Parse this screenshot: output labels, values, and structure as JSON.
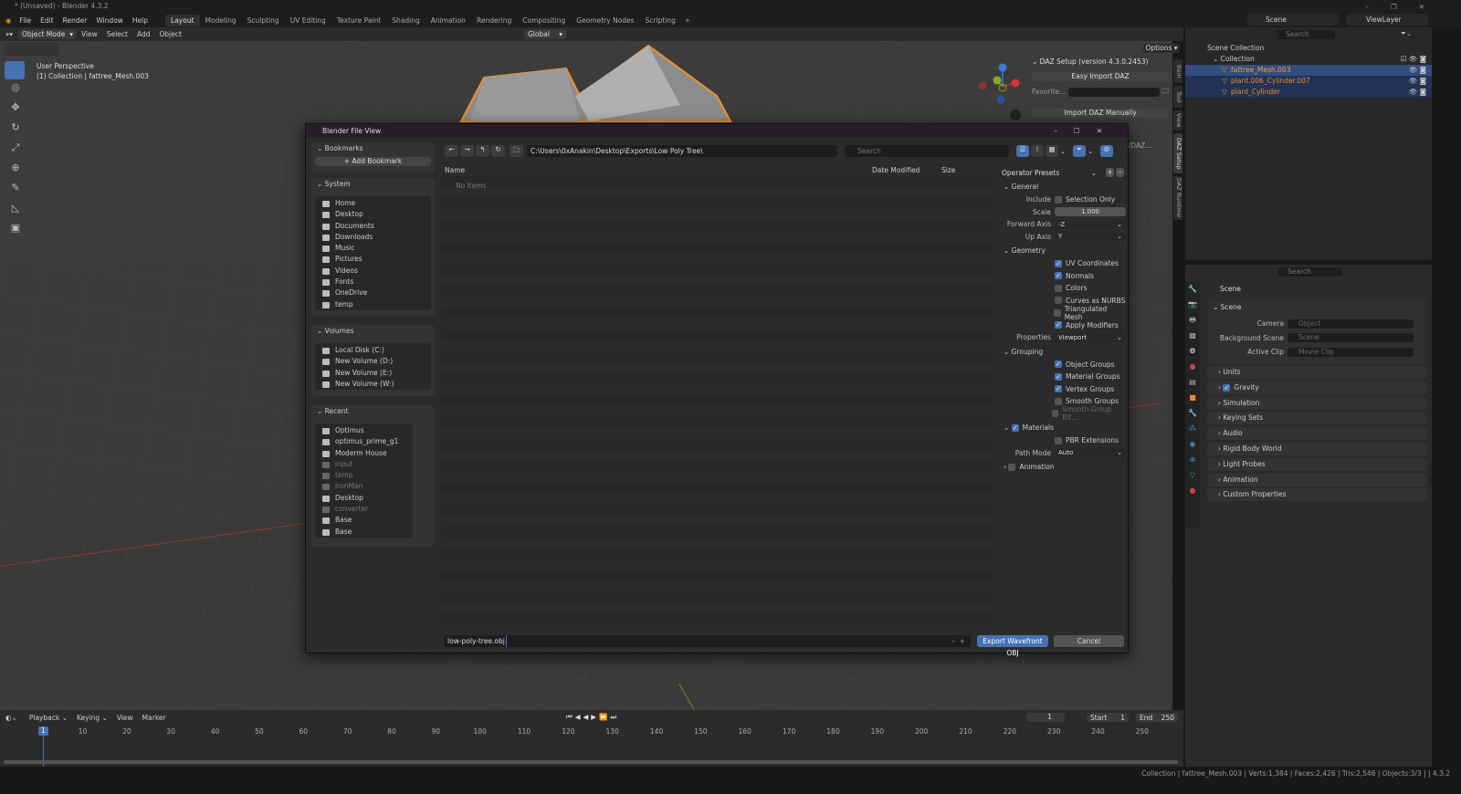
{
  "window": {
    "title": "* (Unsaved) - Blender 4.3.2"
  },
  "menu": [
    "File",
    "Edit",
    "Render",
    "Window",
    "Help"
  ],
  "workspaces": [
    "Layout",
    "Modeling",
    "Sculpting",
    "UV Editing",
    "Texture Paint",
    "Shading",
    "Animation",
    "Rendering",
    "Compositing",
    "Geometry Nodes",
    "Scripting"
  ],
  "active_workspace": "Layout",
  "scene": {
    "label": "Scene",
    "view_layer": "ViewLayer"
  },
  "viewport_header": {
    "mode": "Object Mode",
    "menus": [
      "View",
      "Select",
      "Add",
      "Object"
    ],
    "orientation": "Global",
    "options": "Options"
  },
  "viewport": {
    "perspective": "User Perspective",
    "context": "(1) Collection | fattree_Mesh.003"
  },
  "daz": {
    "title": "DAZ Setup (version 4.3.0.2453)",
    "easy_import": "Easy Import DAZ",
    "favorite_label": "Favorite...",
    "import_manual": "Import DAZ Manually",
    "partial": "D/DAZ..."
  },
  "npanel_tabs": [
    "Item",
    "Tool",
    "View",
    "DAZ Setup",
    "DAZ Runtime"
  ],
  "dialog": {
    "title": "Blender File View",
    "bookmarks": {
      "header": "Bookmarks",
      "add": "Add Bookmark"
    },
    "system": {
      "header": "System",
      "items": [
        "Home",
        "Desktop",
        "Documents",
        "Downloads",
        "Music",
        "Pictures",
        "Videos",
        "Fonts",
        "OneDrive",
        "temp"
      ]
    },
    "volumes": {
      "header": "Volumes",
      "items": [
        "Local Disk (C:)",
        "New Volume (D:)",
        "New Volume (E:)",
        "New Volume (W:)"
      ]
    },
    "recent": {
      "header": "Recent",
      "items": [
        {
          "name": "Optimus",
          "dim": false
        },
        {
          "name": "optimus_prime_g1",
          "dim": false
        },
        {
          "name": "Moderm House",
          "dim": false
        },
        {
          "name": "input",
          "dim": true
        },
        {
          "name": "temp",
          "dim": true
        },
        {
          "name": "IronMan",
          "dim": true
        },
        {
          "name": "Desktop",
          "dim": false
        },
        {
          "name": "converter",
          "dim": true
        },
        {
          "name": "Base",
          "dim": false
        },
        {
          "name": "Base",
          "dim": false
        }
      ]
    },
    "path": "C:\\Users\\0xAnakin\\Desktop\\Exports\\Low Poly Tree\\",
    "search_placeholder": "Search",
    "columns": {
      "name": "Name",
      "date": "Date Modified",
      "size": "Size"
    },
    "empty": "No Items",
    "filename": "low-poly-tree.obj",
    "export": "Export Wavefront OBJ",
    "cancel": "Cancel",
    "operator": {
      "presets": "Operator Presets",
      "general": "General",
      "include_label": "Include",
      "selection_only": "Selection Only",
      "scale_label": "Scale",
      "scale": "1.000",
      "forward_label": "Forward Axis",
      "forward": "-Z",
      "up_label": "Up Axis",
      "up": "Y",
      "geometry": "Geometry",
      "geometry_opts": [
        {
          "label": "UV Coordinates",
          "on": true
        },
        {
          "label": "Normals",
          "on": true
        },
        {
          "label": "Colors",
          "on": false
        },
        {
          "label": "Curves as NURBS",
          "on": false
        },
        {
          "label": "Triangulated Mesh",
          "on": false
        },
        {
          "label": "Apply Modifiers",
          "on": true
        }
      ],
      "properties_label": "Properties",
      "properties": "Viewport",
      "grouping": "Grouping",
      "grouping_opts": [
        {
          "label": "Object Groups",
          "on": true
        },
        {
          "label": "Material Groups",
          "on": true
        },
        {
          "label": "Vertex Groups",
          "on": true
        },
        {
          "label": "Smooth Groups",
          "on": false
        },
        {
          "label": "Smooth Group Bit...",
          "on": false
        }
      ],
      "materials": "Materials",
      "pbr": "PBR Extensions",
      "path_mode_label": "Path Mode",
      "path_mode": "Auto",
      "animation": "Animation"
    }
  },
  "outliner": {
    "search": "Search",
    "scene_collection": "Scene Collection",
    "collection": "Collection",
    "objects": [
      "fattree_Mesh.003",
      "plant.006_Cylinder.007",
      "plant_Cylinder"
    ]
  },
  "properties": {
    "search": "Search",
    "context": "Scene",
    "section": "Scene",
    "camera_label": "Camera",
    "camera": "Object",
    "bg_label": "Background Scene",
    "bg": "Scene",
    "clip_label": "Active Clip",
    "clip": "Movie Clip",
    "sections": [
      "Units",
      "Gravity",
      "Simulation",
      "Keying Sets",
      "Audio",
      "Rigid Body World",
      "Light Probes",
      "Animation",
      "Custom Properties"
    ]
  },
  "timeline": {
    "menus": [
      "Playback",
      "Keying",
      "View",
      "Marker"
    ],
    "current_frame": "1",
    "start_label": "Start",
    "start": "1",
    "end_label": "End",
    "end": "250",
    "ticks": [
      "10",
      "20",
      "30",
      "40",
      "50",
      "60",
      "70",
      "80",
      "90",
      "100",
      "110",
      "120",
      "130",
      "140",
      "150",
      "160",
      "170",
      "180",
      "190",
      "200",
      "210",
      "220",
      "230",
      "240",
      "250"
    ]
  },
  "status": "Collection | fattree_Mesh.003 | Verts:1,384 | Faces:2,426 | Tris:2,546 | Objects:3/3 |  | 4.3.2",
  "colors": {
    "accent": "#4772b3",
    "selected_object": "#e88a2c",
    "title_bar": "#2a1d2a"
  }
}
